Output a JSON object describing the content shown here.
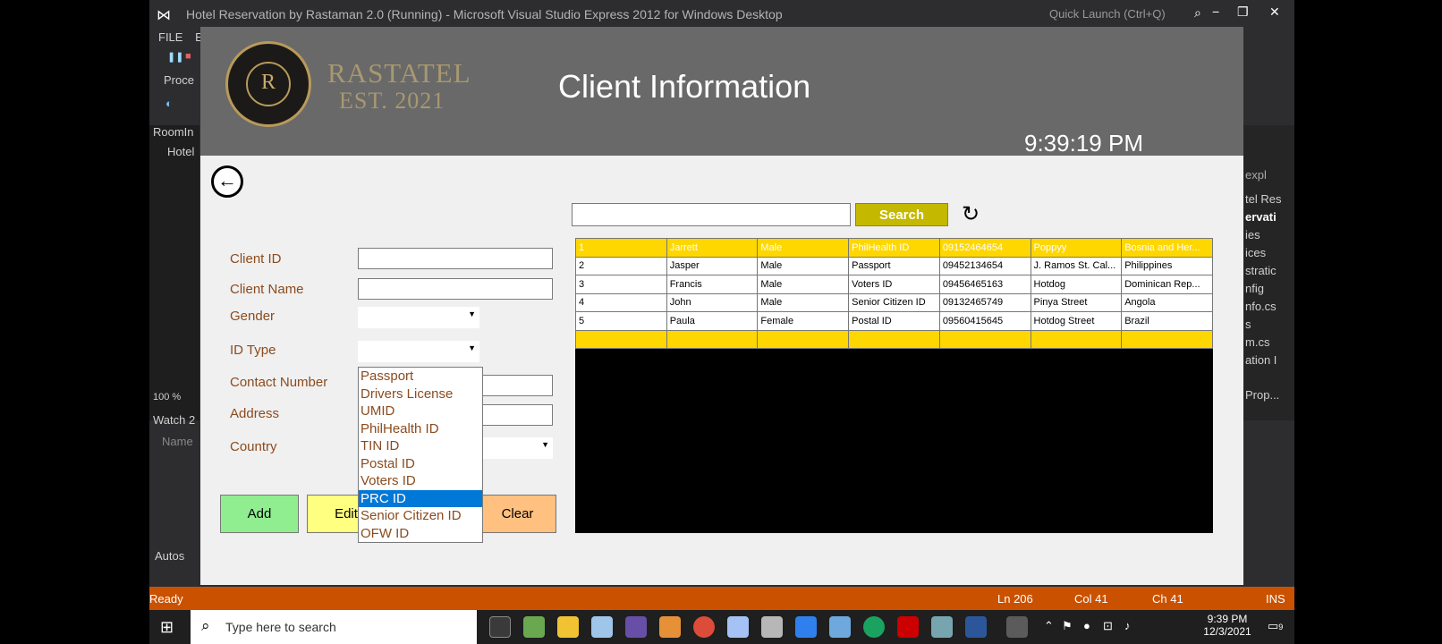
{
  "vs": {
    "title": "Hotel Reservation by Rastaman 2.0 (Running) - Microsoft Visual Studio Express 2012 for Windows Desktop",
    "quick_launch": "Quick Launch (Ctrl+Q)",
    "menu_file": "FILE",
    "menu_edit": "E",
    "side_process": "Proce",
    "tab_room": "RoomIn",
    "tab_hotel": "Hotel",
    "zoom": "100 %",
    "watch": "Watch 2",
    "watch_name": "Name",
    "autos": "Autos",
    "right_items": [
      "expl",
      "tel Res",
      "ervati",
      "ies",
      "ices",
      "stratic",
      "nfig",
      "nfo.cs",
      "s",
      "m.cs",
      "ation I"
    ],
    "right_prop": "Prop...",
    "status": {
      "ready": "Ready",
      "ln": "Ln 206",
      "col": "Col 41",
      "ch": "Ch 41",
      "ins": "INS"
    }
  },
  "app": {
    "brand_name": "RASTATEL",
    "brand_est": "EST. 2021",
    "logo_letter": "R",
    "title": "Client Information",
    "clock": "9:39:19 PM",
    "labels": {
      "client_id": "Client ID",
      "client_name": "Client Name",
      "gender": "Gender",
      "id_type": "ID Type",
      "contact_number": "Contact Number",
      "address": "Address",
      "country": "Country"
    },
    "buttons": {
      "add": "Add",
      "edit": "Edit",
      "clear": "Clear",
      "search": "Search"
    },
    "id_type_options": [
      "Passport",
      "Drivers License",
      "UMID",
      "PhilHealth ID",
      "TIN ID",
      "Postal ID",
      "Voters ID",
      "PRC ID",
      "Senior Citizen ID",
      "OFW ID"
    ],
    "id_type_highlighted": "PRC ID",
    "colors": {
      "header": "#696969",
      "label": "#8b4b1e",
      "row_yellow": "#ffd700",
      "add_button": "#90ee90",
      "edit_button": "#ffff80",
      "clear_button": "#ffc080",
      "search_button": "#c4b800"
    },
    "grid_rows": [
      [
        "1",
        "Jarrett",
        "Male",
        "PhilHealth ID",
        "09152464654",
        "Poppyy",
        "Bosnia and Her..."
      ],
      [
        "2",
        "Jasper",
        "Male",
        "Passport",
        "09452134654",
        "J. Ramos St. Cal...",
        "Philippines"
      ],
      [
        "3",
        "Francis",
        "Male",
        "Voters ID",
        "09456465163",
        "Hotdog",
        "Dominican Rep..."
      ],
      [
        "4",
        "John",
        "Male",
        "Senior Citizen ID",
        "09132465749",
        "Pinya Street",
        "Angola"
      ],
      [
        "5",
        "Paula",
        "Female",
        "Postal ID",
        "09560415645",
        "Hotdog Street",
        "Brazil"
      ],
      [
        "",
        "",
        "",
        "",
        "",
        "",
        ""
      ]
    ]
  },
  "taskbar": {
    "search_placeholder": "Type here to search",
    "time": "9:39 PM",
    "date": "12/3/2021",
    "notification_count": "9"
  }
}
